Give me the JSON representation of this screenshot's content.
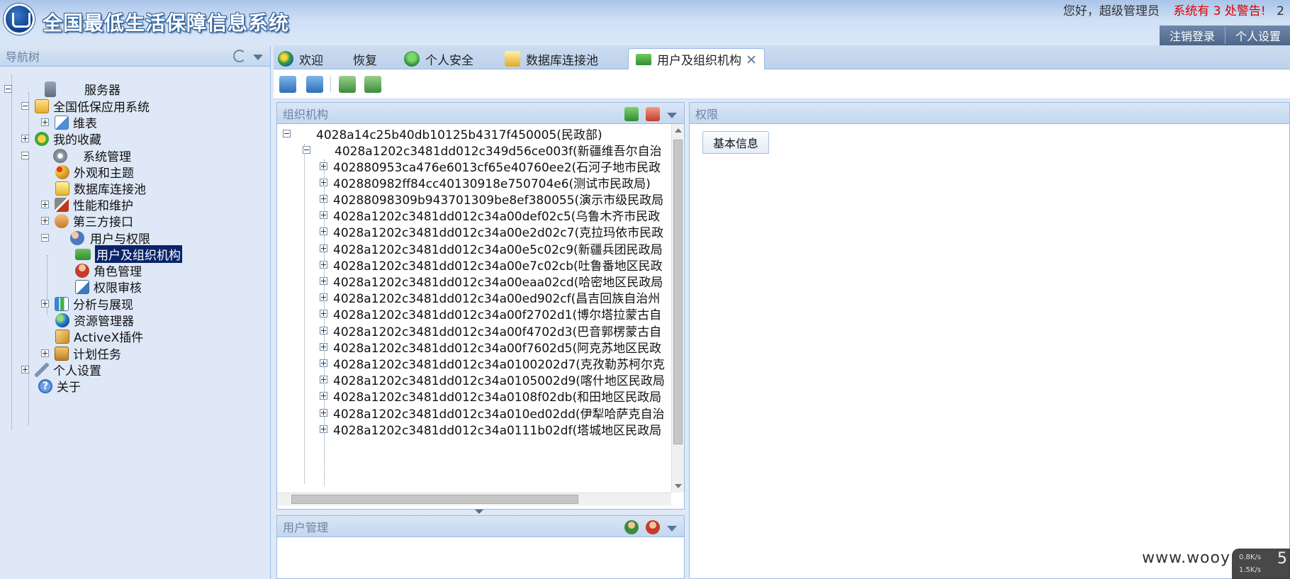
{
  "header": {
    "title": "全国最低生活保障信息系统",
    "greeting": "您好，超级管理员",
    "warning": "系统有 3 处警告!",
    "trailing": "2",
    "actions": [
      "注销登录",
      "个人设置"
    ]
  },
  "nav": {
    "title": "导航树",
    "items": [
      {
        "label": "服务器"
      },
      {
        "label": "全国低保应用系统"
      },
      {
        "label": "维表"
      },
      {
        "label": "我的收藏"
      },
      {
        "label": "系统管理"
      },
      {
        "label": "外观和主题"
      },
      {
        "label": "数据库连接池"
      },
      {
        "label": "性能和维护"
      },
      {
        "label": "第三方接口"
      },
      {
        "label": "用户与权限"
      },
      {
        "label": "用户及组织机构"
      },
      {
        "label": "角色管理"
      },
      {
        "label": "权限审核"
      },
      {
        "label": "分析与展现"
      },
      {
        "label": "资源管理器"
      },
      {
        "label": "ActiveX插件"
      },
      {
        "label": "计划任务"
      },
      {
        "label": "个人设置"
      },
      {
        "label": "关于"
      }
    ]
  },
  "tabs": [
    {
      "label": "欢迎"
    },
    {
      "label": "恢复"
    },
    {
      "label": "个人安全"
    },
    {
      "label": "数据库连接池"
    },
    {
      "label": "用户及组织机构",
      "active": true
    }
  ],
  "org_panel": {
    "title": "组织机构",
    "root": "4028a14c25b40db10125b4317f450005(民政部)",
    "child": "4028a1202c3481dd012c349d56ce003f(新疆维吾尔自治",
    "rows": [
      "402880953ca476e6013cf65e40760ee2(石河子地市民政",
      "402880982ff84cc40130918e750704e6(测试市民政局)",
      "40288098309b943701309be8ef380055(演示市级民政局",
      "4028a1202c3481dd012c34a00def02c5(乌鲁木齐市民政",
      "4028a1202c3481dd012c34a00e2d02c7(克拉玛依市民政",
      "4028a1202c3481dd012c34a00e5c02c9(新疆兵团民政局",
      "4028a1202c3481dd012c34a00e7c02cb(吐鲁番地区民政",
      "4028a1202c3481dd012c34a00eaa02cd(哈密地区民政局",
      "4028a1202c3481dd012c34a00ed902cf(昌吉回族自治州",
      "4028a1202c3481dd012c34a00f2702d1(博尔塔拉蒙古自",
      "4028a1202c3481dd012c34a00f4702d3(巴音郭楞蒙古自",
      "4028a1202c3481dd012c34a00f7602d5(阿克苏地区民政",
      "4028a1202c3481dd012c34a0100202d7(克孜勒苏柯尔克",
      "4028a1202c3481dd012c34a0105002d9(喀什地区民政局",
      "4028a1202c3481dd012c34a0108f02db(和田地区民政局",
      "4028a1202c3481dd012c34a010ed02dd(伊犁哈萨克自治",
      "4028a1202c3481dd012c34a0111b02df(塔城地区民政局"
    ]
  },
  "user_panel": {
    "title": "用户管理"
  },
  "perm_panel": {
    "title": "权限",
    "subtab": "基本信息"
  },
  "footer": {
    "watermark": "www.wooy",
    "net_up": "0.8K/s",
    "net_down": "1.5K/s",
    "net_big": "5"
  }
}
